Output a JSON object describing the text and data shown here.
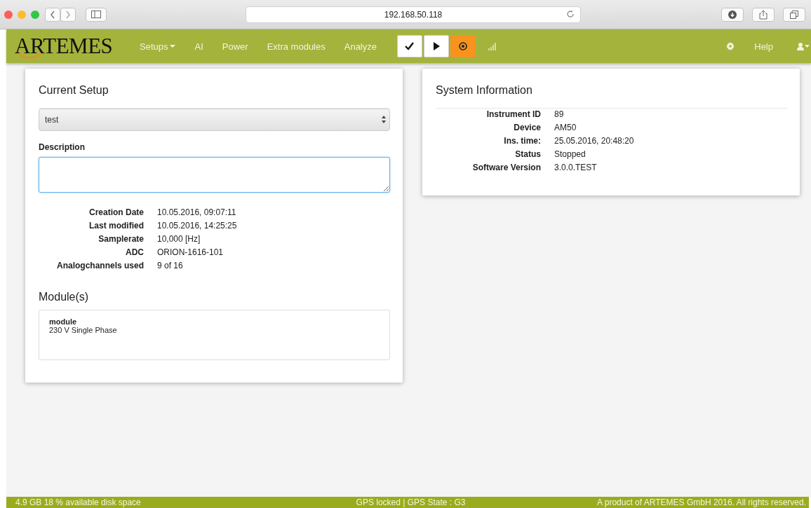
{
  "browser": {
    "url": "192.168.50.118"
  },
  "navbar": {
    "logo": "ARTEMES",
    "menu": [
      {
        "label": "Setups",
        "dropdown": true
      },
      {
        "label": "AI",
        "dropdown": false
      },
      {
        "label": "Power",
        "dropdown": false
      },
      {
        "label": "Extra modules",
        "dropdown": false
      },
      {
        "label": "Analyze",
        "dropdown": false
      }
    ],
    "buttons": [
      {
        "kind": "check"
      },
      {
        "kind": "play"
      },
      {
        "kind": "record"
      }
    ],
    "help": "Help"
  },
  "current_setup": {
    "title": "Current Setup",
    "setup_select": {
      "value": "test"
    },
    "description": {
      "label": "Description",
      "focused": true
    },
    "details": [
      {
        "label": "Creation Date",
        "value": "10.05.2016, 09:07:11"
      },
      {
        "label": "Last modified",
        "value": "10.05.2016, 14:25:25"
      },
      {
        "label": "Samplerate",
        "value": "10,000 [Hz]"
      },
      {
        "label": "ADC",
        "value": "ORION-1616-101"
      },
      {
        "label": "Analogchannels used",
        "value": "9 of 16"
      }
    ],
    "modules_title": "Module(s)",
    "modules": [
      {
        "name": "module",
        "description": "230 V Single Phase"
      }
    ]
  },
  "system_information": {
    "title": "System Information",
    "details": [
      {
        "label": "Instrument ID",
        "value": "89"
      },
      {
        "label": "Device",
        "value": "AM50"
      },
      {
        "label": "Ins. time:",
        "value": "25.05.2016, 20:48:20"
      },
      {
        "label": "Status",
        "value": "Stopped"
      },
      {
        "label": "Software Version",
        "value": "3.0.0.TEST"
      }
    ]
  },
  "footer": {
    "disk": "4.9 GB 18 % available disk space",
    "gps": "GPS locked | GPS State : G3",
    "copyright": "A product of ARTEMES GmbH 2016. All rights reserved."
  }
}
